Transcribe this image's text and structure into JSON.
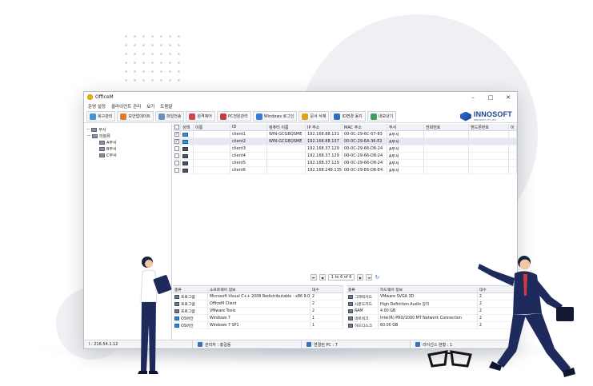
{
  "app": {
    "title": "OfficeM",
    "controls": [
      "–",
      "□",
      "✕"
    ]
  },
  "menu": [
    "운영 설정",
    "클라이언트 관리",
    "보기",
    "도움말"
  ],
  "toolbar": {
    "buttons": [
      {
        "label": "복구관리",
        "color": "#4a90d9"
      },
      {
        "label": "보안업데이트",
        "color": "#e07a2a"
      },
      {
        "label": "파일전송",
        "color": "#6b8fbf"
      },
      {
        "label": "원격제어",
        "color": "#d64545"
      },
      {
        "label": "PC전원관리",
        "color": "#cc3b3b"
      },
      {
        "label": "Windows 로그인",
        "color": "#3a7bd5"
      },
      {
        "label": "문서 삭제",
        "color": "#e3a21a"
      },
      {
        "label": "ID변경 동지",
        "color": "#2f6fbf"
      },
      {
        "label": "내보내기",
        "color": "#3ea05a"
      }
    ]
  },
  "logo": {
    "name": "INNOSOFT",
    "sub": "INNOSOFT CO.,LTD."
  },
  "tree": {
    "items": [
      {
        "label": "부서",
        "level": 0
      },
      {
        "label": "미분류",
        "level": 0
      },
      {
        "label": "A부서",
        "level": 1
      },
      {
        "label": "B부서",
        "level": 1
      },
      {
        "label": "C부서",
        "level": 1
      }
    ]
  },
  "grid": {
    "columns": [
      "상태",
      "이름",
      "ID",
      "컴퓨터 이름",
      "IP 주소",
      "MAC 주소",
      "부서",
      "전화번호",
      "핸드폰번호",
      "이"
    ],
    "rows": [
      {
        "checked": true,
        "online": true,
        "name": "",
        "id": "client1",
        "computer": "WIN-GCGBQSME",
        "ip": "192.168.88.131",
        "mac": "00-0C-29-6C-07-83",
        "dept": "A부서"
      },
      {
        "checked": true,
        "online": true,
        "name": "",
        "id": "client2",
        "computer": "WIN-GCGBQSME",
        "ip": "192.168.88.137",
        "mac": "00-0C-29-6A-36-E2",
        "dept": "A부서"
      },
      {
        "checked": false,
        "online": false,
        "name": "",
        "id": "client3",
        "computer": "",
        "ip": "192.168.37.129",
        "mac": "00-0C-29-66-D8-24",
        "dept": "A부서"
      },
      {
        "checked": false,
        "online": false,
        "name": "",
        "id": "client4",
        "computer": "",
        "ip": "192.168.37.129",
        "mac": "00-0C-29-66-D8-24",
        "dept": "A부서"
      },
      {
        "checked": false,
        "online": false,
        "name": "",
        "id": "client5",
        "computer": "",
        "ip": "192.168.37.129",
        "mac": "00-0C-29-66-D8-24",
        "dept": "A부서"
      },
      {
        "checked": false,
        "online": false,
        "name": "",
        "id": "client6",
        "computer": "",
        "ip": "192.168.248.135",
        "mac": "00-0C-29-E6-D8-E4",
        "dept": "A부서"
      }
    ]
  },
  "pager": {
    "text": "1 to 6 of 6"
  },
  "software": {
    "columns": [
      "종류",
      "소프트웨어 정보",
      "대수"
    ],
    "rows": [
      {
        "type": "프로그램",
        "info": "Microsoft Visual C++ 2008 Redistributable - x86 9.0...",
        "count": "2",
        "win": false
      },
      {
        "type": "프로그램",
        "info": "OfficeM Client",
        "count": "2",
        "win": false
      },
      {
        "type": "프로그램",
        "info": "VMware Tools",
        "count": "2",
        "win": false
      },
      {
        "type": "OS버전",
        "info": "Windows 7",
        "count": "1",
        "win": true
      },
      {
        "type": "OS버전",
        "info": "Windows 7 SP1",
        "count": "1",
        "win": true
      }
    ]
  },
  "hardware": {
    "columns": [
      "종류",
      "하드웨어 정보",
      "대수"
    ],
    "rows": [
      {
        "type": "그래픽카드",
        "info": "VMware SVGA 3D",
        "count": "2"
      },
      {
        "type": "사운드카드",
        "info": "High Definition Audio 장치",
        "count": "2"
      },
      {
        "type": "RAM",
        "info": "4.00 GB",
        "count": "2"
      },
      {
        "type": "네트워크",
        "info": "Intel(R) PRO/1000 MT Network Connection",
        "count": "2"
      },
      {
        "type": "하드디스크",
        "info": "60.00 GB",
        "count": "2"
      }
    ]
  },
  "status": {
    "server": "l : 216.54.1.12",
    "admin": "관리자 : 홍길동",
    "connected": "연결된 PC : 7",
    "license": "라이선스 현황 : 1"
  }
}
